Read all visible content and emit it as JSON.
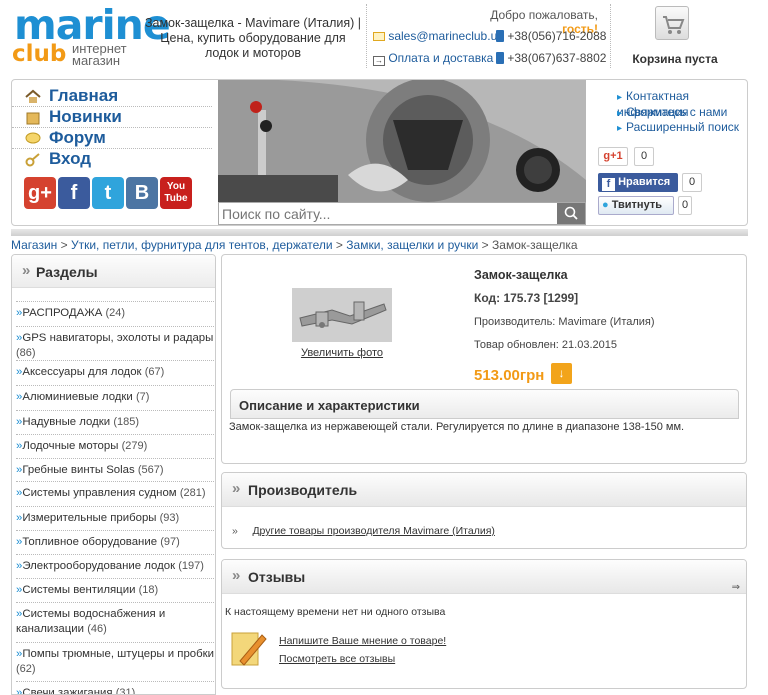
{
  "header": {
    "logo_main": "marine",
    "logo_club": "club",
    "logo_sub": "интернет магазин",
    "title": "Замок-защелка - Mavimare (Италия) | Цена, купить оборудование для лодок и моторов",
    "welcome_prefix": "Добро пожаловать,",
    "welcome_guest": "гость!",
    "email": "sales@marineclub.ua",
    "delivery": "Оплата и доставка",
    "phone1": "+38(056)716-2088",
    "phone2": "+38(067)637-8802",
    "cart": "Корзина пуста"
  },
  "nav": [
    {
      "label": "Главная",
      "icon": "home-icon"
    },
    {
      "label": "Новинки",
      "icon": "box-icon"
    },
    {
      "label": "Форум",
      "icon": "chat-icon"
    },
    {
      "label": "Вход",
      "icon": "key-icon"
    }
  ],
  "social": [
    {
      "name": "gplus",
      "text": "g+",
      "color": "#d5422f"
    },
    {
      "name": "facebook",
      "text": "f",
      "color": "#3b5b9d"
    },
    {
      "name": "twitter",
      "text": "t",
      "color": "#2fa4dc"
    },
    {
      "name": "vkontakte",
      "text": "B",
      "color": "#4c75a3"
    },
    {
      "name": "youtube",
      "text": "You\nTube",
      "color": "#c8201d"
    }
  ],
  "search": {
    "placeholder": "Поиск по сайту..."
  },
  "side_links": [
    "Контактная информация",
    "Свяжитесь с нами",
    "Расширенный поиск"
  ],
  "share": {
    "gplus_label": "+1",
    "gplus_count": "0",
    "fb_label": "Нравится",
    "fb_count": "0",
    "tw_label": "Твитнуть",
    "tw_count": "0"
  },
  "breadcrumb": [
    "Магазин",
    "Утки, петли, фурнитура для тентов, держатели",
    "Замки, защелки и ручки",
    "Замок-защелка"
  ],
  "sidebar": {
    "title": "Разделы",
    "categories": [
      {
        "name": "РАСПРОДАЖА",
        "count": "(24)"
      },
      {
        "name": "GPS навигаторы, эхолоты и радары",
        "count": "(86)"
      },
      {
        "name": "Аксессуары для лодок",
        "count": "(67)"
      },
      {
        "name": "Алюминиевые лодки",
        "count": "(7)"
      },
      {
        "name": "Надувные лодки",
        "count": "(185)"
      },
      {
        "name": "Лодочные моторы",
        "count": "(279)"
      },
      {
        "name": "Гребные винты Solas",
        "count": "(567)"
      },
      {
        "name": "Системы управления судном",
        "count": "(281)"
      },
      {
        "name": "Измерительные приборы",
        "count": "(93)"
      },
      {
        "name": "Топливное оборудование",
        "count": "(97)"
      },
      {
        "name": "Электрооборудование лодок",
        "count": "(197)"
      },
      {
        "name": "Системы вентиляции",
        "count": "(18)"
      },
      {
        "name": "Системы водоснабжения и канализации",
        "count": "(46)"
      },
      {
        "name": "Помпы трюмные, штуцеры и пробки",
        "count": "(62)"
      },
      {
        "name": "Свечи зажигания",
        "count": "(31)"
      }
    ]
  },
  "product": {
    "name": "Замок-защелка",
    "code": "Код: 175.73 [1299]",
    "manufacturer": "Производитель: Mavimare (Италия)",
    "updated": "Товар обновлен: 21.03.2015",
    "price": "513.00грн",
    "enlarge": "Увеличить фото",
    "desc_title": "Описание и характеристики",
    "desc_text": "Замок-защелка из нержавеющей стали. Регулируется по длине в диапазоне 138-150 мм."
  },
  "manufacturer_box": {
    "title": "Производитель",
    "link": "Другие товары производителя Mavimare (Италия)"
  },
  "reviews": {
    "title": "Отзывы",
    "none": "К настоящему времени нет ни одного отзыва",
    "write": "Напишите Ваше мнение о товаре!",
    "view_all": "Посмотреть все отзывы"
  }
}
